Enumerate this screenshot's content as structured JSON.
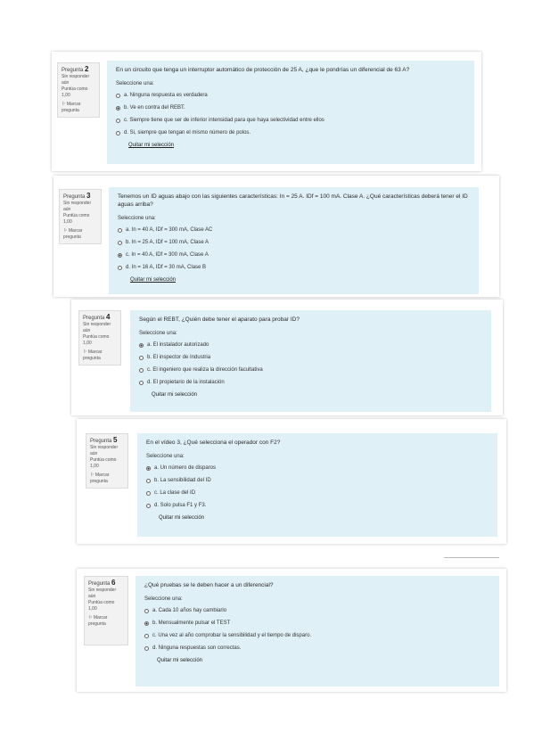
{
  "questions": [
    {
      "label": "Pregunta",
      "number": "2",
      "status": "Sin responder aún",
      "points": "Puntúa como 1,00",
      "flag": "Marcar pregunta",
      "text": "En un circuito que tenga un interruptor automático de protección de 25 A, ¿que le pondrías un diferencial de 63 A?",
      "prompt": "Seleccione una:",
      "options": [
        {
          "text": "a. Ninguna respuesta es verdadera",
          "selected": false
        },
        {
          "text": "b. Ve en contra del REBT.",
          "selected": true
        },
        {
          "text": "c. Siempre tiene que ser de inferior intensidad para que haya selectividad entre ellos",
          "selected": false
        },
        {
          "text": "d. Si, siempre que tengan el mismo número de polos.",
          "selected": false
        }
      ],
      "clear": "Quitar mi selección"
    },
    {
      "label": "Pregunta",
      "number": "3",
      "status": "Sin responder aún",
      "points": "Puntúa como 1,00",
      "flag": "Marcar pregunta",
      "text": "Tenemos un ID aguas abajo con las siguientes características: In = 25 A. IDf = 100 mA. Clase A. ¿Qué características deberá tener el ID aguas arriba?",
      "prompt": "Seleccione una:",
      "options": [
        {
          "text": "a. In = 40 A, IDf = 300 mA, Clase AC",
          "selected": false
        },
        {
          "text": "b. In = 25 A, IDf = 100 mA, Clase A",
          "selected": false
        },
        {
          "text": "c. In = 40 A, IDf = 300 mA, Clase A",
          "selected": true
        },
        {
          "text": "d. In = 16 A, IDf = 30 mA, Clase B",
          "selected": false
        }
      ],
      "clear": "Quitar mi selección"
    },
    {
      "label": "Pregunta",
      "number": "4",
      "status": "Sin responder aún",
      "points": "Puntúa como 1,00",
      "flag": "Marcar pregunta",
      "text": "Según el REBT, ¿Quién debe tener el aparato para probar ID?",
      "prompt": "Seleccione una:",
      "options": [
        {
          "text": "a. El instalador autorizado",
          "selected": true
        },
        {
          "text": "b. El inspector de Industria",
          "selected": false
        },
        {
          "text": "c. El ingeniero que realiza la dirección facultativa",
          "selected": false
        },
        {
          "text": "d. El propietario de la instalación",
          "selected": false
        }
      ],
      "clear": "Quitar mi selección"
    },
    {
      "label": "Pregunta",
      "number": "5",
      "status": "Sin responder aún",
      "points": "Puntúa como 1,00",
      "flag": "Marcar pregunta",
      "text": "En el vídeo 3, ¿Qué selecciona el operador con F2?",
      "prompt": "Seleccione una:",
      "options": [
        {
          "text": "a. Un número de disparos",
          "selected": true
        },
        {
          "text": "b. La sensibilidad del ID",
          "selected": false
        },
        {
          "text": "c. La clase del ID",
          "selected": false
        },
        {
          "text": "d. Solo pulsa F1 y F3.",
          "selected": false
        }
      ],
      "clear": "Quitar mi selección"
    },
    {
      "label": "Pregunta",
      "number": "6",
      "status": "Sin responder aún",
      "points": "Puntúa como 1,00",
      "flag": "Marcar pregunta",
      "text": "¿Qué pruebas se le deben hacer a un diferencial?",
      "prompt": "Seleccione una:",
      "options": [
        {
          "text": "a. Cada 10 años hay cambiarlo",
          "selected": false
        },
        {
          "text": "b. Mensualmente pulsar el TEST",
          "selected": true
        },
        {
          "text": "c. Una vez al año comprobar la sensibilidad y el tiempo de disparo.",
          "selected": false
        },
        {
          "text": "d. Ninguna respuestas son correctas.",
          "selected": false
        }
      ],
      "clear": "Quitar mi selección"
    }
  ]
}
